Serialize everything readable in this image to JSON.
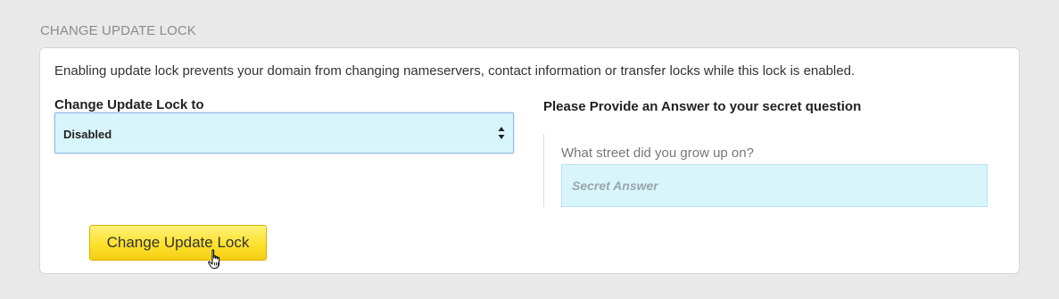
{
  "section": {
    "title": "CHANGE UPDATE LOCK"
  },
  "panel": {
    "description": "Enabling update lock prevents your domain from changing nameservers, contact information or transfer locks while this lock is enabled."
  },
  "lock_field": {
    "label": "Change Update Lock to",
    "selected": "Disabled",
    "icon": "select-arrows-icon"
  },
  "answer_field": {
    "label": "Please Provide an Answer to your secret question",
    "question": "What street did you grow up on?",
    "placeholder": "Secret Answer",
    "value": ""
  },
  "submit": {
    "label": "Change Update Lock"
  },
  "cursor": {
    "icon": "hand-pointer-icon"
  },
  "colors": {
    "page_bg": "#e9e9e9",
    "input_bg": "#d9f5fc",
    "button_yellow": "#fde12d"
  }
}
